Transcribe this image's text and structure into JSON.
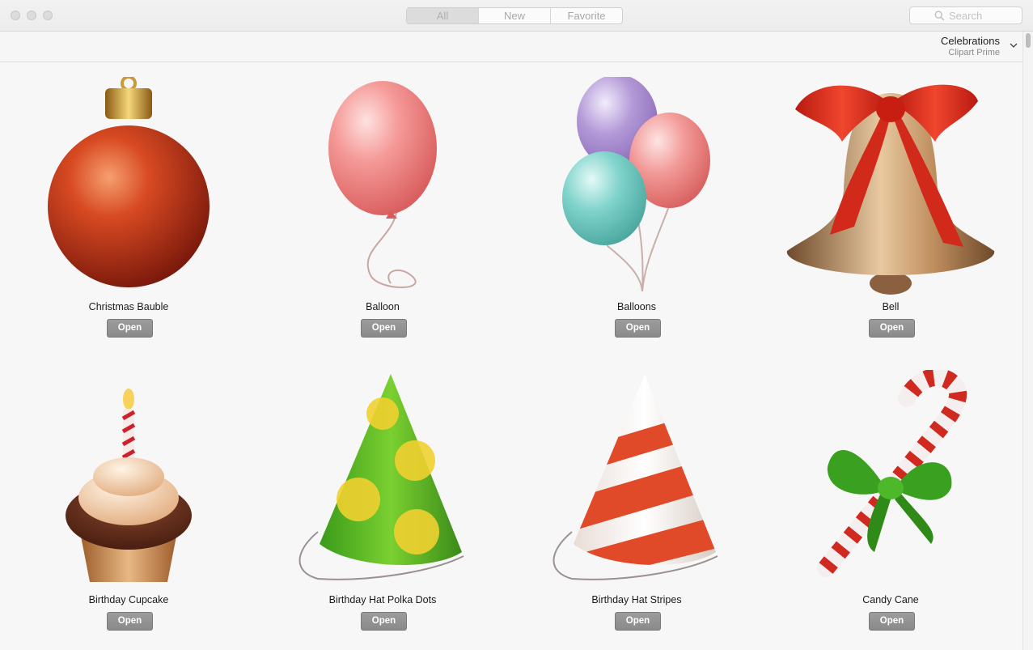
{
  "tabs": [
    "All",
    "New",
    "Favorite"
  ],
  "active_tab": "All",
  "search": {
    "placeholder": "Search"
  },
  "category": {
    "title": "Celebrations",
    "subtitle": "Clipart Prime"
  },
  "items": [
    {
      "name": "Christmas Bauble",
      "button": "Open",
      "icon": "christmas-bauble"
    },
    {
      "name": "Balloon",
      "button": "Open",
      "icon": "balloon"
    },
    {
      "name": "Balloons",
      "button": "Open",
      "icon": "balloons"
    },
    {
      "name": "Bell",
      "button": "Open",
      "icon": "bell"
    },
    {
      "name": "Birthday Cupcake",
      "button": "Open",
      "icon": "birthday-cupcake"
    },
    {
      "name": "Birthday Hat Polka Dots",
      "button": "Open",
      "icon": "birthday-hat-polka-dots"
    },
    {
      "name": "Birthday Hat Stripes",
      "button": "Open",
      "icon": "birthday-hat-stripes"
    },
    {
      "name": "Candy Cane",
      "button": "Open",
      "icon": "candy-cane"
    }
  ]
}
